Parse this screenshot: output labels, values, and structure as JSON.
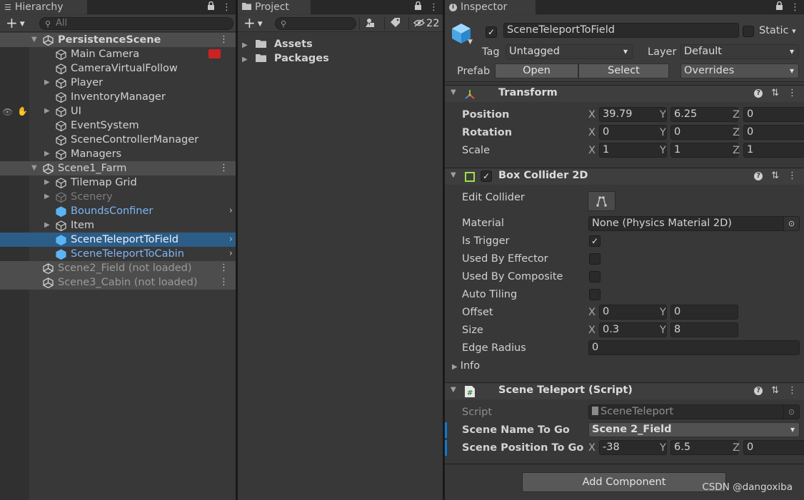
{
  "hierarchy": {
    "tab_label": "Hierarchy",
    "search_placeholder": "All",
    "rows": [
      {
        "label": "PersistenceScene",
        "kind": "scene",
        "expanded": true,
        "bold": true
      },
      {
        "label": "Main Camera",
        "kind": "object",
        "depth": 1,
        "badge": "camera"
      },
      {
        "label": "CameraVirtualFollow",
        "kind": "object",
        "depth": 1
      },
      {
        "label": "Player",
        "kind": "object",
        "depth": 1,
        "collapsed": true
      },
      {
        "label": "InventoryManager",
        "kind": "object",
        "depth": 1
      },
      {
        "label": "UI",
        "kind": "object",
        "depth": 1,
        "collapsed": true,
        "hover": true
      },
      {
        "label": "EventSystem",
        "kind": "object",
        "depth": 1
      },
      {
        "label": "SceneControllerManager",
        "kind": "object",
        "depth": 1
      },
      {
        "label": "Managers",
        "kind": "object",
        "depth": 1,
        "collapsed": true
      },
      {
        "label": "Scene1_Farm",
        "kind": "scene",
        "expanded": true
      },
      {
        "label": "Tilemap Grid",
        "kind": "object",
        "depth": 1,
        "collapsed": true
      },
      {
        "label": "Scenery",
        "kind": "object",
        "depth": 1,
        "collapsed": true,
        "inactive": true
      },
      {
        "label": "BoundsConfiner",
        "kind": "prefab",
        "depth": 1,
        "arrow": true
      },
      {
        "label": "Item",
        "kind": "object",
        "depth": 1,
        "collapsed": true
      },
      {
        "label": "SceneTeleportToField",
        "kind": "prefab",
        "depth": 1,
        "arrow": true,
        "selected": true
      },
      {
        "label": "SceneTeleportToCabin",
        "kind": "prefab",
        "depth": 1,
        "arrow": true
      },
      {
        "label": "Scene2_Field (not loaded)",
        "kind": "scene",
        "unloaded": true
      },
      {
        "label": "Scene3_Cabin (not loaded)",
        "kind": "scene",
        "unloaded": true
      }
    ]
  },
  "project": {
    "tab_label": "Project",
    "hidden_count": "22",
    "folders": [
      "Assets",
      "Packages"
    ]
  },
  "inspector": {
    "tab_label": "Inspector",
    "object_name": "SceneTeleportToField",
    "static_label": "Static",
    "tag_label": "Tag",
    "tag_value": "Untagged",
    "layer_label": "Layer",
    "layer_value": "Default",
    "prefab_label": "Prefab",
    "open_label": "Open",
    "select_label": "Select",
    "overrides_label": "Overrides",
    "transform": {
      "title": "Transform",
      "position_label": "Position",
      "rotation_label": "Rotation",
      "scale_label": "Scale",
      "position": {
        "x": "39.79",
        "y": "6.25",
        "z": "0"
      },
      "rotation": {
        "x": "0",
        "y": "0",
        "z": "0"
      },
      "scale": {
        "x": "1",
        "y": "1",
        "z": "1"
      }
    },
    "box_collider": {
      "title": "Box Collider 2D",
      "edit_collider_label": "Edit Collider",
      "material_label": "Material",
      "material_value": "None (Physics Material 2D)",
      "is_trigger_label": "Is Trigger",
      "used_by_effector_label": "Used By Effector",
      "used_by_composite_label": "Used By Composite",
      "auto_tiling_label": "Auto Tiling",
      "offset_label": "Offset",
      "offset": {
        "x": "0",
        "y": "0"
      },
      "size_label": "Size",
      "size": {
        "x": "0.3",
        "y": "8"
      },
      "edge_radius_label": "Edge Radius",
      "edge_radius_value": "0",
      "info_label": "Info"
    },
    "scene_teleport": {
      "title": "Scene Teleport (Script)",
      "script_label": "Script",
      "script_value": "SceneTeleport",
      "scene_name_label": "Scene Name To Go",
      "scene_name_value": "Scene 2_Field",
      "scene_position_label": "Scene Position To Go",
      "scene_position": {
        "x": "-38",
        "y": "6.5",
        "z": "0"
      }
    },
    "add_component_label": "Add Component"
  },
  "axis_labels": {
    "x": "X",
    "y": "Y",
    "z": "Z"
  },
  "watermark": "CSDN @dangoxiba",
  "colors": {
    "selection": "#2c5d87",
    "prefab_text": "#7cb4f4",
    "accent_blue": "#0f7ad3"
  }
}
